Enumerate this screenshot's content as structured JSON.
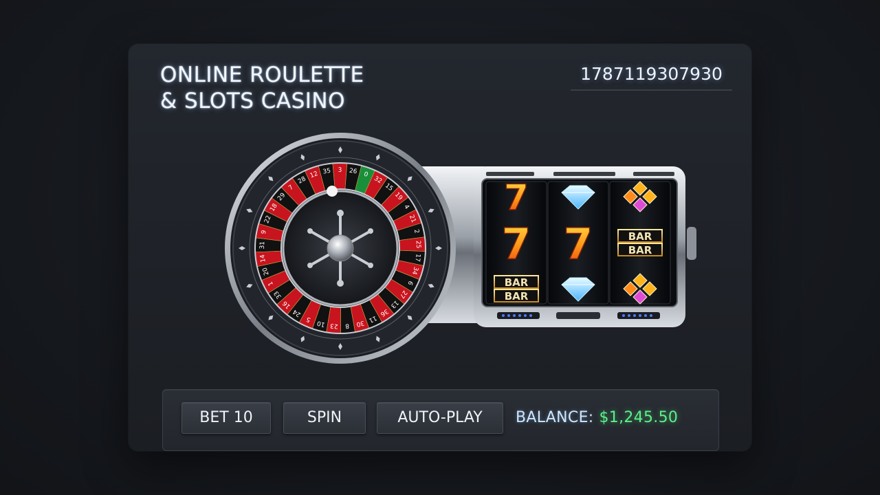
{
  "header": {
    "title_line1": "ONLINE ROULETTE",
    "title_line2": "& SLOTS CASINO",
    "game_id": "1787119307930"
  },
  "roulette": {
    "numbers": [
      "0",
      "32",
      "15",
      "19",
      "4",
      "21",
      "2",
      "25",
      "17",
      "34",
      "6",
      "27",
      "13",
      "36",
      "11",
      "30",
      "8",
      "23",
      "10",
      "5",
      "24",
      "16",
      "33",
      "1",
      "20",
      "14",
      "31",
      "9",
      "22",
      "18",
      "29",
      "7",
      "28",
      "12",
      "35",
      "3",
      "26"
    ]
  },
  "slots": {
    "reels": [
      [
        "seven",
        "seven",
        "bar"
      ],
      [
        "diamond",
        "seven",
        "diamond"
      ],
      [
        "gem",
        "bar",
        "gem"
      ]
    ],
    "bar_text": "BAR"
  },
  "controls": {
    "bet_label": "BET 10",
    "spin_label": "SPIN",
    "autoplay_label": "AUTO-PLAY",
    "balance_label": "BALANCE:",
    "balance_value": "$1,245.50"
  },
  "colors": {
    "accent_green": "#5cf08a",
    "roulette_red": "#c8141e",
    "roulette_black": "#111111",
    "zero_green": "#1a8f3a"
  }
}
